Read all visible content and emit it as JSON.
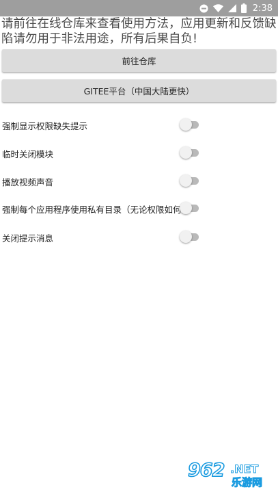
{
  "status_bar": {
    "time": "2:38",
    "icons": [
      "do-not-disturb-icon",
      "wifi-icon",
      "signal-icon",
      "battery-icon"
    ]
  },
  "notice": {
    "text": "请前往在线仓库来查看使用方法，应用更新和反馈缺陷请勿用于非法用途，所有后果自负!"
  },
  "buttons": {
    "repo_label": "前往仓库",
    "gitee_label": "GITEE平台（中国大陆更快）"
  },
  "settings": [
    {
      "label": "强制显示权限缺失提示",
      "enabled": false
    },
    {
      "label": "临时关闭模块",
      "enabled": false
    },
    {
      "label": "播放视频声音",
      "enabled": false
    },
    {
      "label": "强制每个应用程序使用私有目录（无论权限如何）",
      "enabled": false
    },
    {
      "label": "关闭提示消息",
      "enabled": false
    }
  ],
  "watermark": {
    "number": "962",
    "net": ".NET",
    "cn": "乐游网"
  },
  "colors": {
    "status_bar": "#9e9e9e",
    "button_bg": "#dcdcdc",
    "switch_track": "#b9b9b9",
    "switch_thumb": "#f1f1f1",
    "watermark_blue": "#1a9be0"
  }
}
